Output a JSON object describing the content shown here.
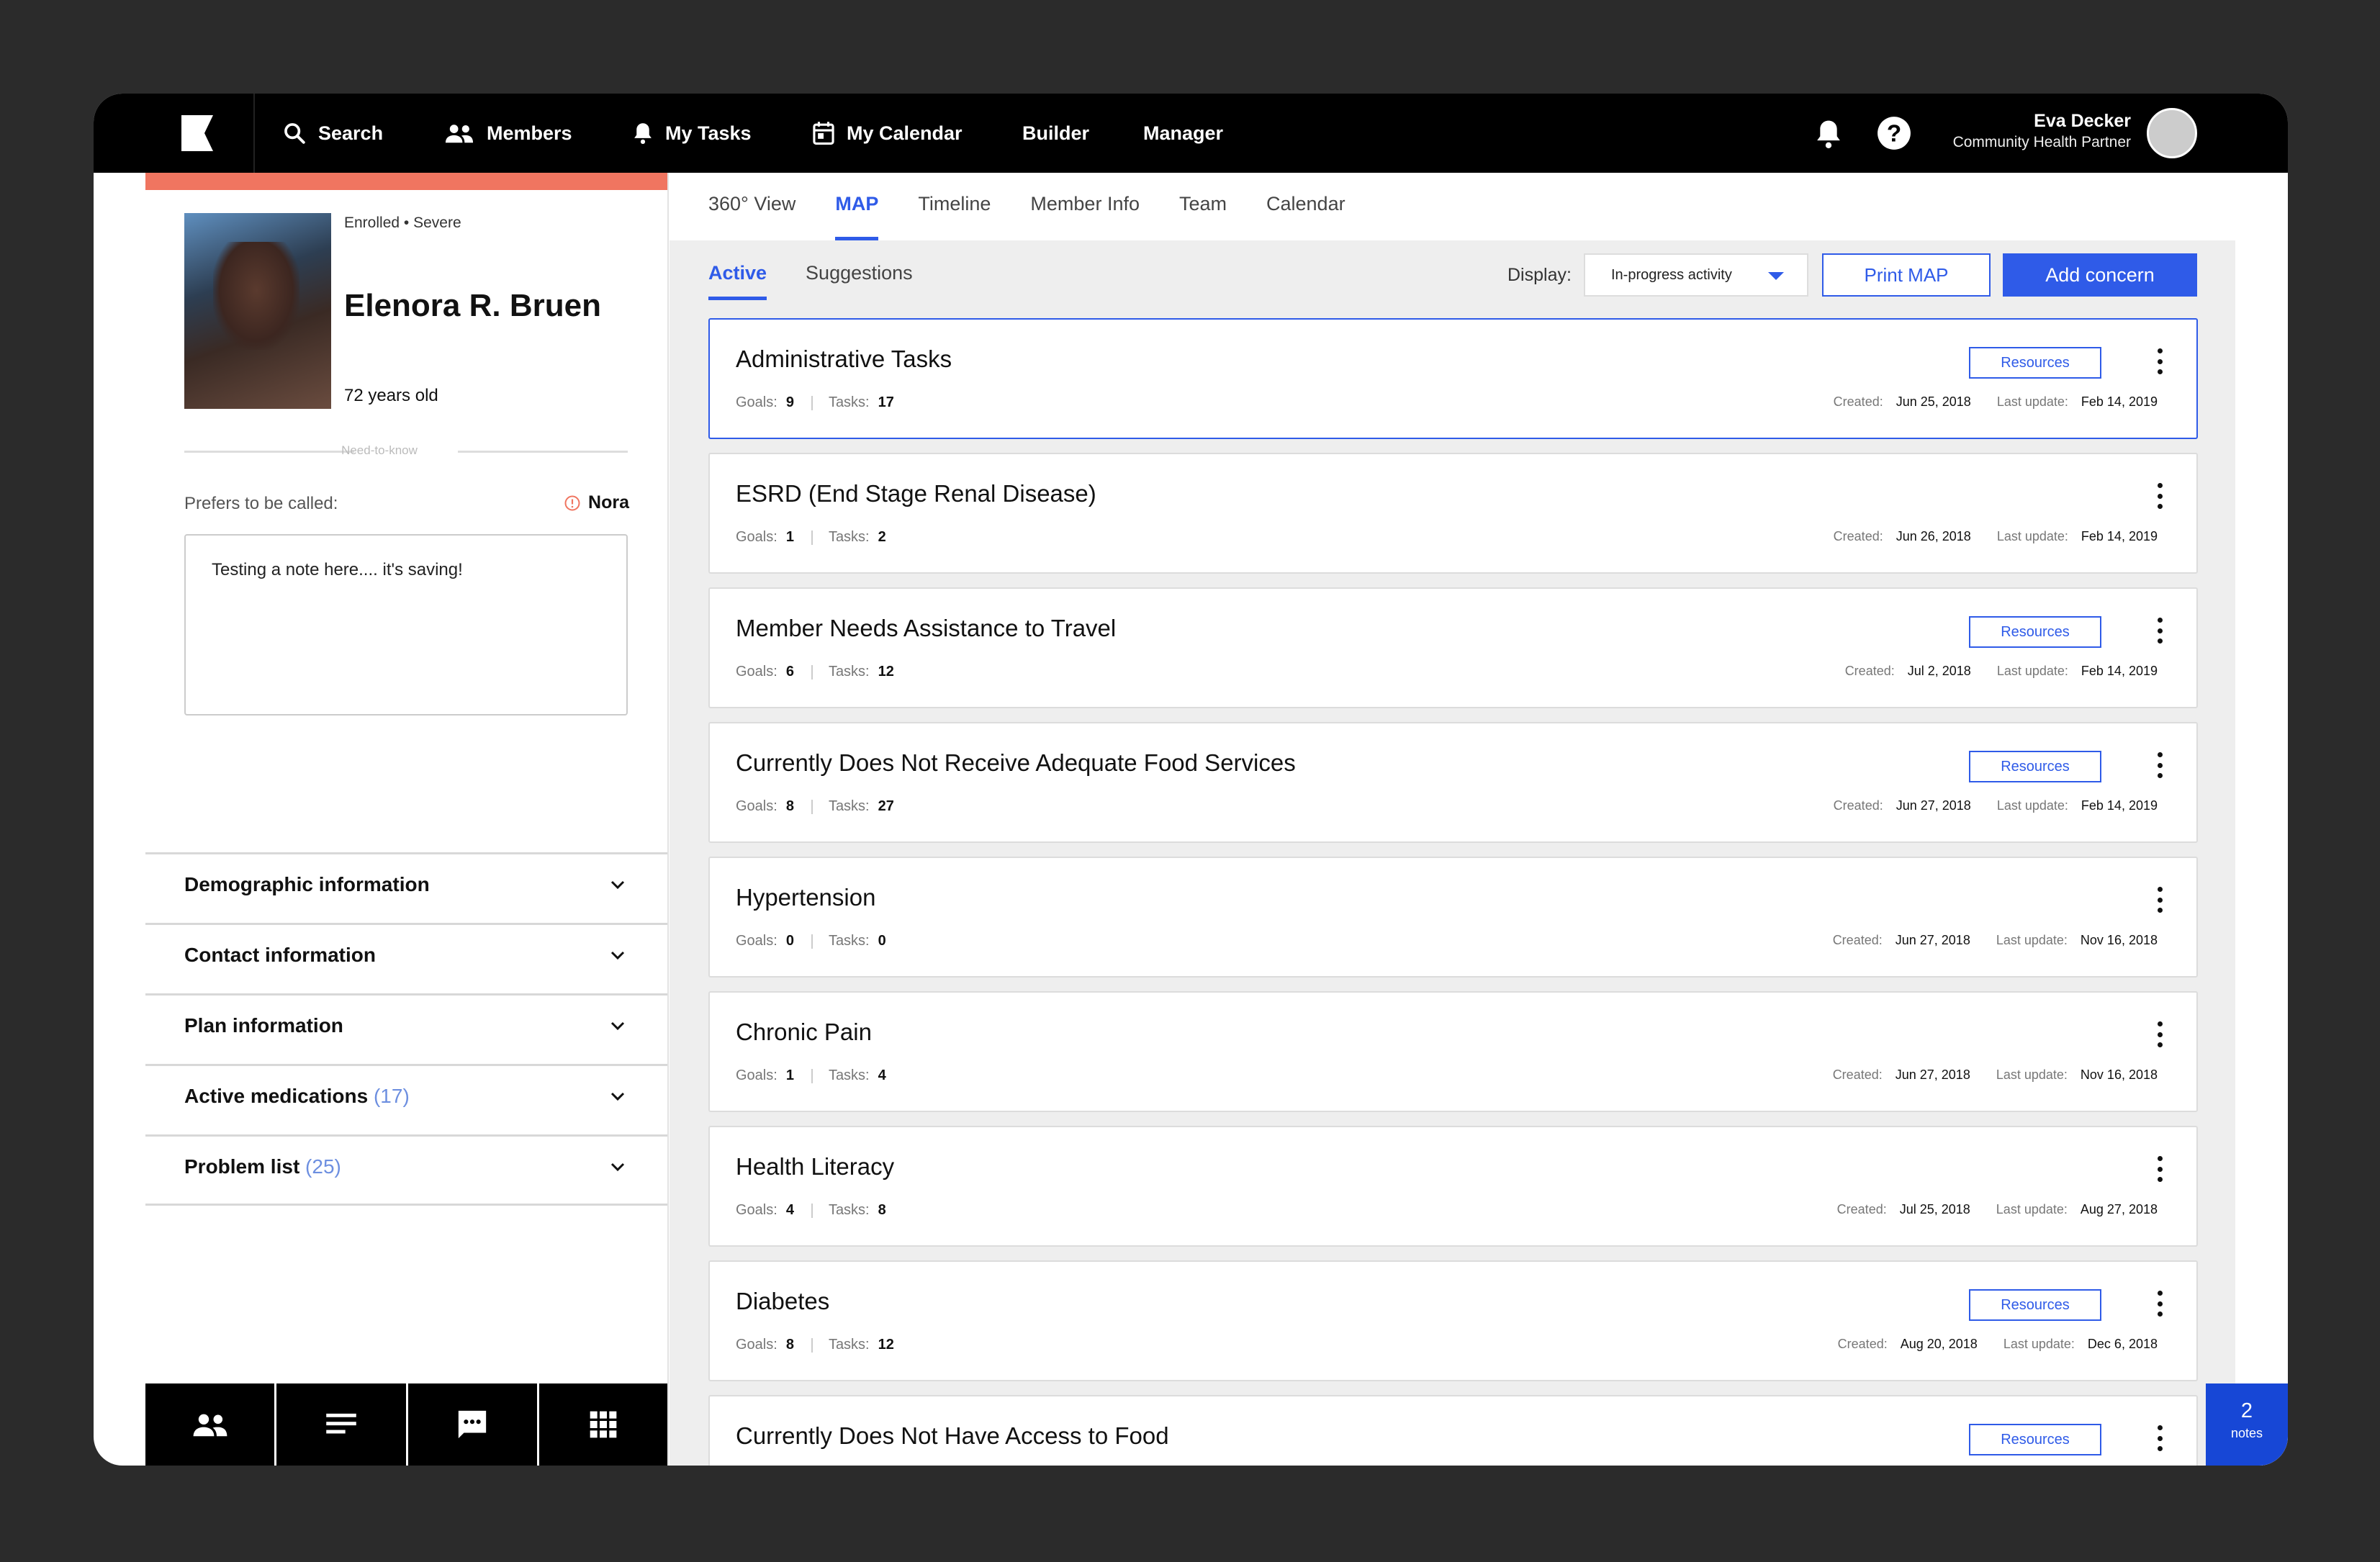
{
  "nav": {
    "search": "Search",
    "members": "Members",
    "my_tasks": "My Tasks",
    "my_calendar": "My Calendar",
    "builder": "Builder",
    "manager": "Manager"
  },
  "user": {
    "name": "Eva Decker",
    "role": "Community Health Partner"
  },
  "member": {
    "enrolled": "Enrolled",
    "severity": "Severe",
    "name": "Elenora R. Bruen",
    "age": "72 years old",
    "need_to_know": "Need-to-know",
    "prefers_label": "Prefers to be called:",
    "preferred_name": "Nora",
    "note": "Testing a note here.... it's saving!"
  },
  "accordions": [
    {
      "label": "Demographic information",
      "count": ""
    },
    {
      "label": "Contact information",
      "count": ""
    },
    {
      "label": "Plan information",
      "count": ""
    },
    {
      "label": "Active medications",
      "count": "(17)"
    },
    {
      "label": "Problem list",
      "count": "(25)"
    }
  ],
  "tabs": [
    "360° View",
    "MAP",
    "Timeline",
    "Member Info",
    "Team",
    "Calendar"
  ],
  "active_tab": "MAP",
  "subtabs": [
    "Active",
    "Suggestions"
  ],
  "display": {
    "label": "Display:",
    "value": "In-progress activity"
  },
  "buttons": {
    "print": "Print MAP",
    "add": "Add concern",
    "resources": "Resources"
  },
  "labels": {
    "goals": "Goals:",
    "tasks": "Tasks:",
    "created": "Created:",
    "last_update": "Last update:"
  },
  "concerns": [
    {
      "title": "Administrative Tasks",
      "goals": "9",
      "tasks": "17",
      "created": "Jun 25, 2018",
      "updated": "Feb 14, 2019",
      "resources": true
    },
    {
      "title": "ESRD (End Stage Renal Disease)",
      "goals": "1",
      "tasks": "2",
      "created": "Jun 26, 2018",
      "updated": "Feb 14, 2019",
      "resources": false
    },
    {
      "title": "Member Needs Assistance to Travel",
      "goals": "6",
      "tasks": "12",
      "created": "Jul 2, 2018",
      "updated": "Feb 14, 2019",
      "resources": true
    },
    {
      "title": "Currently Does Not Receive Adequate Food Services",
      "goals": "8",
      "tasks": "27",
      "created": "Jun 27, 2018",
      "updated": "Feb 14, 2019",
      "resources": true
    },
    {
      "title": "Hypertension",
      "goals": "0",
      "tasks": "0",
      "created": "Jun 27, 2018",
      "updated": "Nov 16, 2018",
      "resources": false
    },
    {
      "title": "Chronic Pain",
      "goals": "1",
      "tasks": "4",
      "created": "Jun 27, 2018",
      "updated": "Nov 16, 2018",
      "resources": false
    },
    {
      "title": "Health Literacy",
      "goals": "4",
      "tasks": "8",
      "created": "Jul 25, 2018",
      "updated": "Aug 27, 2018",
      "resources": false
    },
    {
      "title": "Diabetes",
      "goals": "8",
      "tasks": "12",
      "created": "Aug 20, 2018",
      "updated": "Dec 6, 2018",
      "resources": true
    },
    {
      "title": "Currently Does Not Have Access to Food",
      "goals": "",
      "tasks": "",
      "created": "",
      "updated": "",
      "resources": true
    }
  ],
  "notes": {
    "count": "2",
    "label": "notes"
  },
  "colors": {
    "accent": "#2f5be8",
    "alert": "#f07560",
    "notes_badge": "#1747d6"
  }
}
